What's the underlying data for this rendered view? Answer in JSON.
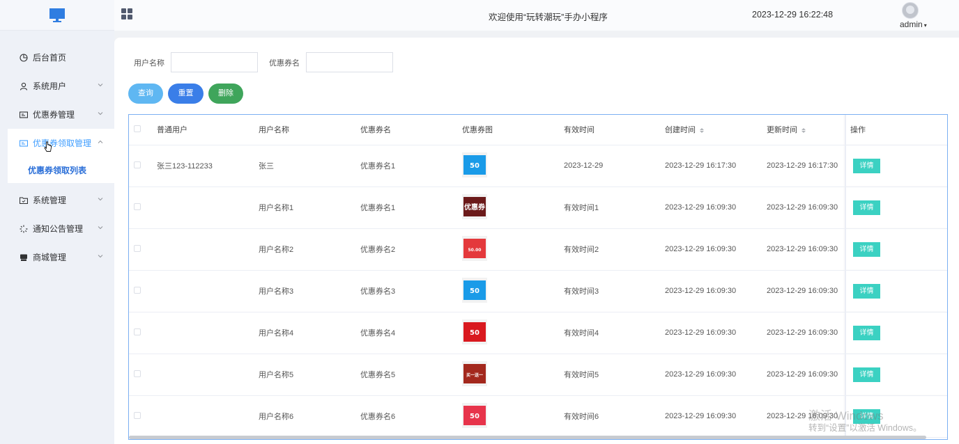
{
  "header": {
    "title": "欢迎使用“玩转潮玩”手办小程序",
    "datetime": "2023-12-29 16:22:48",
    "username": "admin",
    "caret": "▾"
  },
  "sidebar": {
    "items": [
      {
        "label": "后台首页",
        "icon": "pie-chart-icon"
      },
      {
        "label": "系统用户",
        "icon": "user-icon",
        "arrow": "⌄"
      },
      {
        "label": "优惠券管理",
        "icon": "coupon-card-icon",
        "arrow": "⌄"
      },
      {
        "label": "优惠券领取管理",
        "icon": "coupon-card-icon",
        "arrow": "⌃"
      },
      {
        "label": "系统管理",
        "icon": "folder-check-icon",
        "arrow": "⌄"
      },
      {
        "label": "通知公告管理",
        "icon": "loading-icon",
        "arrow": "⌄"
      },
      {
        "label": "商城管理",
        "icon": "shop-icon",
        "arrow": "⌄"
      }
    ],
    "sub_item": "优惠券领取列表"
  },
  "search": {
    "username_label": "用户名称",
    "username_value": "",
    "coupon_label": "优惠券名",
    "coupon_value": ""
  },
  "buttons": {
    "search": "查询",
    "reset": "重置",
    "delete": "删除"
  },
  "table": {
    "columns": [
      "普通用户",
      "用户名称",
      "优惠券名",
      "优惠券图",
      "有效时间",
      "创建时间",
      "更新时间",
      "操作"
    ],
    "rows": [
      {
        "user": "张三123-112233",
        "name": "张三",
        "coupon": "优惠券名1",
        "image": "blue",
        "valid": "2023-12-29",
        "created": "2023-12-29 16:17:30",
        "updated": "2023-12-29 16:17:30",
        "action": "详情"
      },
      {
        "user": "",
        "name": "用户名称1",
        "coupon": "优惠券名1",
        "image": "dark",
        "valid": "有效时间1",
        "created": "2023-12-29 16:09:30",
        "updated": "2023-12-29 16:09:30",
        "action": "详情"
      },
      {
        "user": "",
        "name": "用户名称2",
        "coupon": "优惠券名2",
        "image": "red",
        "valid": "有效时间2",
        "created": "2023-12-29 16:09:30",
        "updated": "2023-12-29 16:09:30",
        "action": "详情"
      },
      {
        "user": "",
        "name": "用户名称3",
        "coupon": "优惠券名3",
        "image": "blue",
        "valid": "有效时间3",
        "created": "2023-12-29 16:09:30",
        "updated": "2023-12-29 16:09:30",
        "action": "详情"
      },
      {
        "user": "",
        "name": "用户名称4",
        "coupon": "优惠券名4",
        "image": "red-small",
        "valid": "有效时间4",
        "created": "2023-12-29 16:09:30",
        "updated": "2023-12-29 16:09:30",
        "action": "详情"
      },
      {
        "user": "",
        "name": "用户名称5",
        "coupon": "优惠券名5",
        "image": "maroon",
        "valid": "有效时间5",
        "created": "2023-12-29 16:09:30",
        "updated": "2023-12-29 16:09:30",
        "action": "详情"
      },
      {
        "user": "",
        "name": "用户名称6",
        "coupon": "优惠券名6",
        "image": "pink",
        "valid": "有效时间6",
        "created": "2023-12-29 16:09:30",
        "updated": "2023-12-29 16:09:30",
        "action": "详情"
      }
    ]
  },
  "coupon_images": {
    "blue": {
      "bg": "#1a9be8",
      "text": "50"
    },
    "dark": {
      "bg": "#6b1a1a",
      "text": "优惠券"
    },
    "red": {
      "bg": "#e4393c",
      "text": "50.00"
    },
    "red-small": {
      "bg": "#d9191f",
      "text": "50"
    },
    "maroon": {
      "bg": "#a3281d",
      "text": "买一送一"
    },
    "pink": {
      "bg": "#e7344b",
      "text": "50"
    }
  },
  "watermark": {
    "line1": "激活 Windows",
    "line2": "转到“设置”以激活 Windows。"
  },
  "colors": {
    "accent": "#409eff",
    "search_btn": "#5fb7f2",
    "reset_btn": "#3a7ee8",
    "delete_btn": "#3fa55b",
    "detail_btn": "#3bd1c2"
  }
}
